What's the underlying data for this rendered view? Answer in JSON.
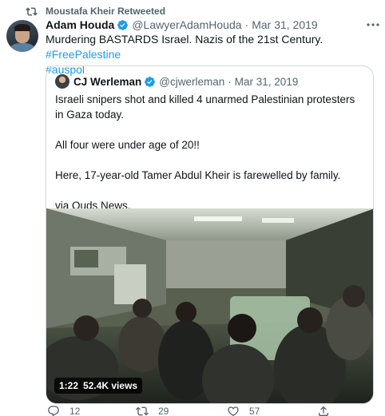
{
  "retweet_context": {
    "text": "Moustafa Kheir Retweeted",
    "icon": "retweet-icon"
  },
  "tweet": {
    "author_name": "Adam Houda",
    "author_handle": "@LawyerAdamHouda",
    "separator": "·",
    "date": "Mar 31, 2019",
    "text": "Murdering BASTARDS Israel. Nazis of the 21st Century.",
    "hashtags": [
      "#FreePalestine",
      "#auspol"
    ],
    "more_icon": "more-icon"
  },
  "quoted_tweet": {
    "author_name": "CJ Werleman",
    "author_handle": "@cjwerleman",
    "separator": "·",
    "date": "Mar 31, 2019",
    "paragraphs": [
      "Israeli snipers shot and killed 4 unarmed Palestinian protesters in Gaza today.",
      "All four were under age of 20!!",
      "Here, 17-year-old Tamer Abdul Kheir is farewelled by family.",
      "via Quds News."
    ],
    "video": {
      "duration": "1:22",
      "views": "52.4K views"
    }
  },
  "actions": {
    "reply_count": "12",
    "retweet_count": "29",
    "like_count": "57"
  },
  "colors": {
    "link": "#1d9bf0",
    "secondary_text": "#536471",
    "border": "#cfd9de",
    "verified": "#1d9bf0"
  }
}
